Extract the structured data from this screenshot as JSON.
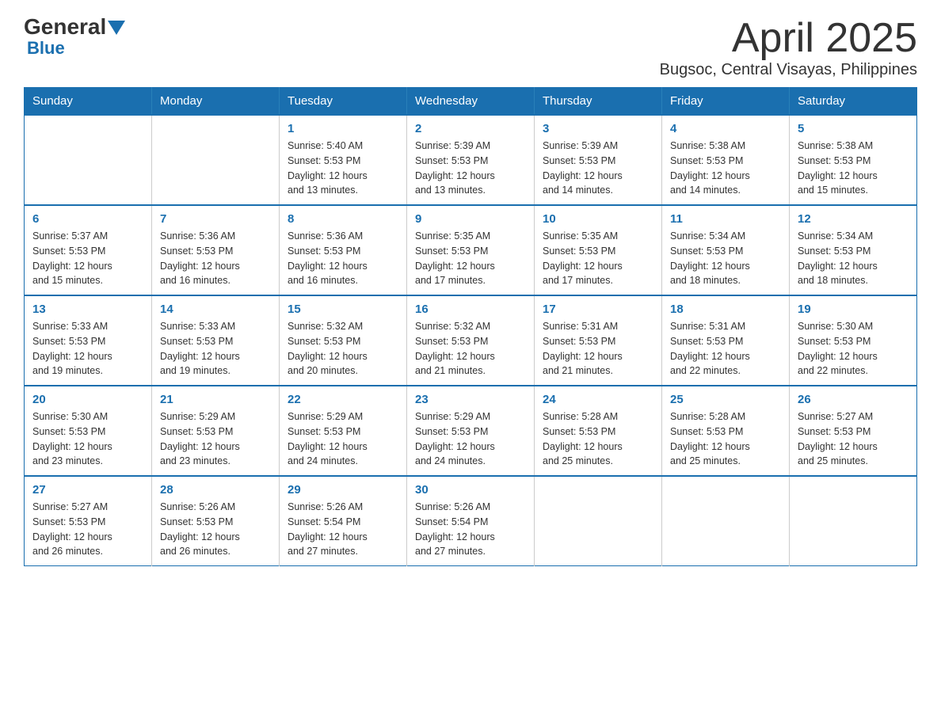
{
  "header": {
    "logo_line1": "General",
    "logo_line2": "Blue",
    "title": "April 2025",
    "subtitle": "Bugsoc, Central Visayas, Philippines"
  },
  "weekdays": [
    "Sunday",
    "Monday",
    "Tuesday",
    "Wednesday",
    "Thursday",
    "Friday",
    "Saturday"
  ],
  "weeks": [
    [
      {
        "day": "",
        "info": ""
      },
      {
        "day": "",
        "info": ""
      },
      {
        "day": "1",
        "info": "Sunrise: 5:40 AM\nSunset: 5:53 PM\nDaylight: 12 hours\nand 13 minutes."
      },
      {
        "day": "2",
        "info": "Sunrise: 5:39 AM\nSunset: 5:53 PM\nDaylight: 12 hours\nand 13 minutes."
      },
      {
        "day": "3",
        "info": "Sunrise: 5:39 AM\nSunset: 5:53 PM\nDaylight: 12 hours\nand 14 minutes."
      },
      {
        "day": "4",
        "info": "Sunrise: 5:38 AM\nSunset: 5:53 PM\nDaylight: 12 hours\nand 14 minutes."
      },
      {
        "day": "5",
        "info": "Sunrise: 5:38 AM\nSunset: 5:53 PM\nDaylight: 12 hours\nand 15 minutes."
      }
    ],
    [
      {
        "day": "6",
        "info": "Sunrise: 5:37 AM\nSunset: 5:53 PM\nDaylight: 12 hours\nand 15 minutes."
      },
      {
        "day": "7",
        "info": "Sunrise: 5:36 AM\nSunset: 5:53 PM\nDaylight: 12 hours\nand 16 minutes."
      },
      {
        "day": "8",
        "info": "Sunrise: 5:36 AM\nSunset: 5:53 PM\nDaylight: 12 hours\nand 16 minutes."
      },
      {
        "day": "9",
        "info": "Sunrise: 5:35 AM\nSunset: 5:53 PM\nDaylight: 12 hours\nand 17 minutes."
      },
      {
        "day": "10",
        "info": "Sunrise: 5:35 AM\nSunset: 5:53 PM\nDaylight: 12 hours\nand 17 minutes."
      },
      {
        "day": "11",
        "info": "Sunrise: 5:34 AM\nSunset: 5:53 PM\nDaylight: 12 hours\nand 18 minutes."
      },
      {
        "day": "12",
        "info": "Sunrise: 5:34 AM\nSunset: 5:53 PM\nDaylight: 12 hours\nand 18 minutes."
      }
    ],
    [
      {
        "day": "13",
        "info": "Sunrise: 5:33 AM\nSunset: 5:53 PM\nDaylight: 12 hours\nand 19 minutes."
      },
      {
        "day": "14",
        "info": "Sunrise: 5:33 AM\nSunset: 5:53 PM\nDaylight: 12 hours\nand 19 minutes."
      },
      {
        "day": "15",
        "info": "Sunrise: 5:32 AM\nSunset: 5:53 PM\nDaylight: 12 hours\nand 20 minutes."
      },
      {
        "day": "16",
        "info": "Sunrise: 5:32 AM\nSunset: 5:53 PM\nDaylight: 12 hours\nand 21 minutes."
      },
      {
        "day": "17",
        "info": "Sunrise: 5:31 AM\nSunset: 5:53 PM\nDaylight: 12 hours\nand 21 minutes."
      },
      {
        "day": "18",
        "info": "Sunrise: 5:31 AM\nSunset: 5:53 PM\nDaylight: 12 hours\nand 22 minutes."
      },
      {
        "day": "19",
        "info": "Sunrise: 5:30 AM\nSunset: 5:53 PM\nDaylight: 12 hours\nand 22 minutes."
      }
    ],
    [
      {
        "day": "20",
        "info": "Sunrise: 5:30 AM\nSunset: 5:53 PM\nDaylight: 12 hours\nand 23 minutes."
      },
      {
        "day": "21",
        "info": "Sunrise: 5:29 AM\nSunset: 5:53 PM\nDaylight: 12 hours\nand 23 minutes."
      },
      {
        "day": "22",
        "info": "Sunrise: 5:29 AM\nSunset: 5:53 PM\nDaylight: 12 hours\nand 24 minutes."
      },
      {
        "day": "23",
        "info": "Sunrise: 5:29 AM\nSunset: 5:53 PM\nDaylight: 12 hours\nand 24 minutes."
      },
      {
        "day": "24",
        "info": "Sunrise: 5:28 AM\nSunset: 5:53 PM\nDaylight: 12 hours\nand 25 minutes."
      },
      {
        "day": "25",
        "info": "Sunrise: 5:28 AM\nSunset: 5:53 PM\nDaylight: 12 hours\nand 25 minutes."
      },
      {
        "day": "26",
        "info": "Sunrise: 5:27 AM\nSunset: 5:53 PM\nDaylight: 12 hours\nand 25 minutes."
      }
    ],
    [
      {
        "day": "27",
        "info": "Sunrise: 5:27 AM\nSunset: 5:53 PM\nDaylight: 12 hours\nand 26 minutes."
      },
      {
        "day": "28",
        "info": "Sunrise: 5:26 AM\nSunset: 5:53 PM\nDaylight: 12 hours\nand 26 minutes."
      },
      {
        "day": "29",
        "info": "Sunrise: 5:26 AM\nSunset: 5:54 PM\nDaylight: 12 hours\nand 27 minutes."
      },
      {
        "day": "30",
        "info": "Sunrise: 5:26 AM\nSunset: 5:54 PM\nDaylight: 12 hours\nand 27 minutes."
      },
      {
        "day": "",
        "info": ""
      },
      {
        "day": "",
        "info": ""
      },
      {
        "day": "",
        "info": ""
      }
    ]
  ]
}
